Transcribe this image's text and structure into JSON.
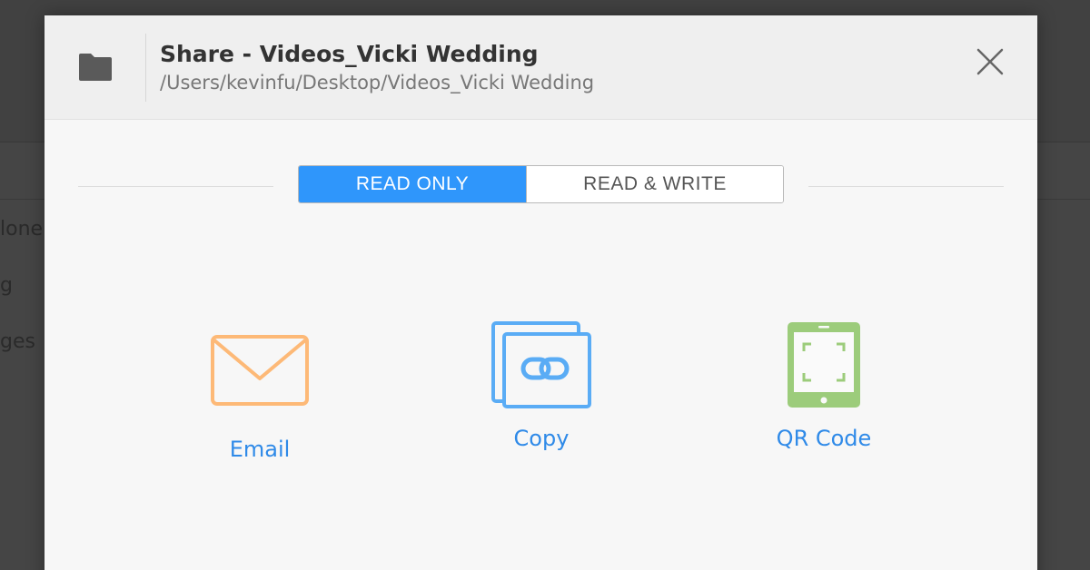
{
  "background": {
    "items": [
      "lone",
      "g",
      "ges"
    ]
  },
  "dialog": {
    "title": "Share - Videos_Vicki Wedding",
    "path": "/Users/kevinfu/Desktop/Videos_Vicki Wedding",
    "icons": {
      "folder": "folder-icon",
      "close": "close-icon"
    }
  },
  "permissions": {
    "options": [
      "READ ONLY",
      "READ & WRITE"
    ],
    "selected": "READ ONLY",
    "active_color": "#2f96fb"
  },
  "share_options": [
    {
      "label": "Email",
      "icon": "envelope-icon",
      "color": "#fdb977"
    },
    {
      "label": "Copy",
      "icon": "link-icon",
      "color": "#5aacf5"
    },
    {
      "label": "QR Code",
      "icon": "qr-tablet-icon",
      "color": "#9ccc7b"
    }
  ],
  "link_color": "#2f8ae8"
}
